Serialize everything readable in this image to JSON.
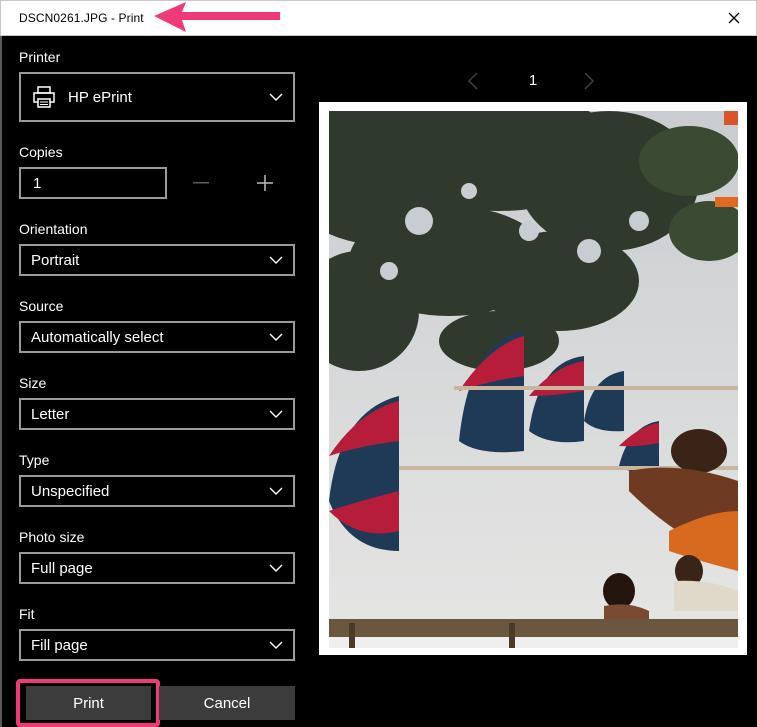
{
  "window": {
    "title": "DSCN0261.JPG - Print",
    "close_icon": "close-icon"
  },
  "printer": {
    "label": "Printer",
    "value": "HP ePrint",
    "icon": "printer-icon"
  },
  "copies": {
    "label": "Copies",
    "value": "1",
    "decrement_icon": "minus-icon",
    "increment_icon": "plus-icon"
  },
  "orientation": {
    "label": "Orientation",
    "value": "Portrait"
  },
  "source": {
    "label": "Source",
    "value": "Automatically select"
  },
  "size": {
    "label": "Size",
    "value": "Letter"
  },
  "type": {
    "label": "Type",
    "value": "Unspecified"
  },
  "photo_size": {
    "label": "Photo size",
    "value": "Full page"
  },
  "fit": {
    "label": "Fit",
    "value": "Fill page"
  },
  "actions": {
    "print_label": "Print",
    "cancel_label": "Cancel"
  },
  "preview": {
    "page_number": "1",
    "prev_icon": "chevron-left-icon",
    "next_icon": "chevron-right-icon"
  },
  "colors": {
    "background": "#000000",
    "control_border": "#9a9a9a",
    "button_bg": "#3c3c3c",
    "annotation": "#f03a77"
  }
}
